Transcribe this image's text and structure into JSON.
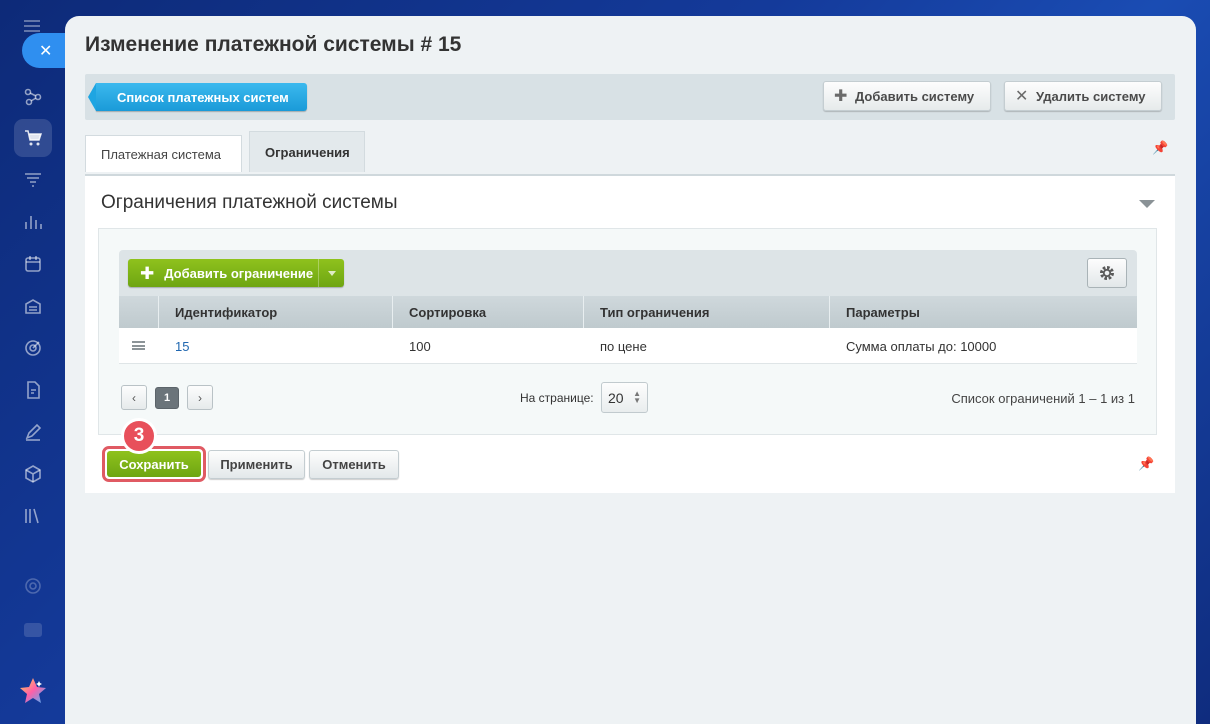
{
  "page": {
    "title": "Изменение платежной системы # 15"
  },
  "toolbar": {
    "back_label": "Список платежных систем",
    "add_system_label": "Добавить систему",
    "delete_system_label": "Удалить систему"
  },
  "tabs": [
    {
      "label": "Платежная система",
      "active": false
    },
    {
      "label": "Ограничения",
      "active": true
    }
  ],
  "section": {
    "title": "Ограничения платежной системы"
  },
  "grid": {
    "add_label": "Добавить ограничение",
    "columns": [
      "Идентификатор",
      "Сортировка",
      "Тип ограничения",
      "Параметры"
    ],
    "rows": [
      {
        "id": "15",
        "sort": "100",
        "type": "по цене",
        "params": "Сумма оплаты до: 10000"
      }
    ]
  },
  "pager": {
    "prev": "‹",
    "current": "1",
    "next": "›",
    "per_page_label": "На странице:",
    "per_page_value": "20",
    "count_text": "Список ограничений 1 – 1 из 1"
  },
  "footer": {
    "save_label": "Сохранить",
    "apply_label": "Применить",
    "cancel_label": "Отменить"
  },
  "annotation": {
    "step": "3"
  },
  "colors": {
    "accent_blue": "#1a9ad8",
    "accent_green": "#7ab317",
    "highlight_red": "#e05a63"
  },
  "icons": {
    "rail": [
      "hamburger-icon",
      "close-icon",
      "share-icon",
      "cart-icon",
      "funnel-icon",
      "bar-chart-icon",
      "calendar-icon",
      "warehouse-icon",
      "target-icon",
      "document-edit-icon",
      "pencil-icon",
      "box-icon",
      "books-icon",
      "settings-icon",
      "chat-icon",
      "star-icon"
    ]
  }
}
